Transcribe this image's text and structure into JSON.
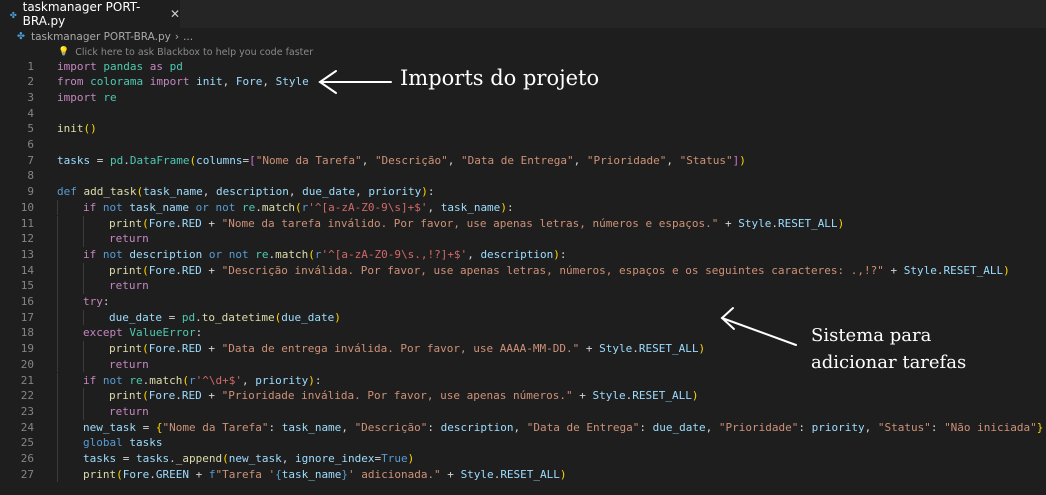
{
  "tab": {
    "label": "taskmanager PORT-BRA.py",
    "close": "✕"
  },
  "breadcrumb": {
    "file": "taskmanager PORT-BRA.py",
    "sep": "›",
    "rest": "..."
  },
  "hint": "Click here to ask Blackbox to help you code faster",
  "annotations": {
    "imports": "Imports do projeto",
    "sistema_line1": "Sistema para",
    "sistema_line2": "adicionar tarefas"
  },
  "code": [
    {
      "n": "1",
      "indent": 0,
      "tokens": [
        [
          "kw",
          "import"
        ],
        [
          "txt",
          " "
        ],
        [
          "cls",
          "pandas"
        ],
        [
          "txt",
          " "
        ],
        [
          "kw",
          "as"
        ],
        [
          "txt",
          " "
        ],
        [
          "cls",
          "pd"
        ]
      ]
    },
    {
      "n": "2",
      "indent": 0,
      "tokens": [
        [
          "kw",
          "from"
        ],
        [
          "txt",
          " "
        ],
        [
          "cls",
          "colorama"
        ],
        [
          "txt",
          " "
        ],
        [
          "kw",
          "import"
        ],
        [
          "txt",
          " "
        ],
        [
          "var",
          "init"
        ],
        [
          "txt",
          ", "
        ],
        [
          "var",
          "Fore"
        ],
        [
          "txt",
          ", "
        ],
        [
          "var",
          "Style"
        ]
      ]
    },
    {
      "n": "3",
      "indent": 0,
      "tokens": [
        [
          "kw",
          "import"
        ],
        [
          "txt",
          " "
        ],
        [
          "cls",
          "re"
        ]
      ]
    },
    {
      "n": "4",
      "indent": 0,
      "tokens": []
    },
    {
      "n": "5",
      "indent": 0,
      "tokens": [
        [
          "fn",
          "init"
        ],
        [
          "p1",
          "()"
        ]
      ]
    },
    {
      "n": "6",
      "indent": 0,
      "tokens": []
    },
    {
      "n": "7",
      "indent": 0,
      "tokens": [
        [
          "var",
          "tasks"
        ],
        [
          "txt",
          " = "
        ],
        [
          "cls",
          "pd"
        ],
        [
          "txt",
          "."
        ],
        [
          "cls",
          "DataFrame"
        ],
        [
          "p1",
          "("
        ],
        [
          "var",
          "columns"
        ],
        [
          "txt",
          "="
        ],
        [
          "p2",
          "["
        ],
        [
          "str",
          "\"Nome da Tarefa\""
        ],
        [
          "txt",
          ", "
        ],
        [
          "str",
          "\"Descrição\""
        ],
        [
          "txt",
          ", "
        ],
        [
          "str",
          "\"Data de Entrega\""
        ],
        [
          "txt",
          ", "
        ],
        [
          "str",
          "\"Prioridade\""
        ],
        [
          "txt",
          ", "
        ],
        [
          "str",
          "\"Status\""
        ],
        [
          "p2",
          "]"
        ],
        [
          "p1",
          ")"
        ]
      ]
    },
    {
      "n": "8",
      "indent": 0,
      "tokens": []
    },
    {
      "n": "9",
      "indent": 0,
      "tokens": [
        [
          "kwb",
          "def"
        ],
        [
          "txt",
          " "
        ],
        [
          "fn",
          "add_task"
        ],
        [
          "p1",
          "("
        ],
        [
          "var",
          "task_name"
        ],
        [
          "txt",
          ", "
        ],
        [
          "var",
          "description"
        ],
        [
          "txt",
          ", "
        ],
        [
          "var",
          "due_date"
        ],
        [
          "txt",
          ", "
        ],
        [
          "var",
          "priority"
        ],
        [
          "p1",
          ")"
        ],
        [
          "txt",
          ":"
        ]
      ]
    },
    {
      "n": "10",
      "indent": 1,
      "tokens": [
        [
          "kw",
          "if"
        ],
        [
          "txt",
          " "
        ],
        [
          "kwb",
          "not"
        ],
        [
          "txt",
          " "
        ],
        [
          "var",
          "task_name"
        ],
        [
          "txt",
          " "
        ],
        [
          "kwb",
          "or"
        ],
        [
          "txt",
          " "
        ],
        [
          "kwb",
          "not"
        ],
        [
          "txt",
          " "
        ],
        [
          "cls",
          "re"
        ],
        [
          "txt",
          "."
        ],
        [
          "fn",
          "match"
        ],
        [
          "p1",
          "("
        ],
        [
          "kwb",
          "r"
        ],
        [
          "rx",
          "'^[a-zA-Z0-9\\s]+$'"
        ],
        [
          "txt",
          ", "
        ],
        [
          "var",
          "task_name"
        ],
        [
          "p1",
          ")"
        ],
        [
          "txt",
          ":"
        ]
      ]
    },
    {
      "n": "11",
      "indent": 2,
      "tokens": [
        [
          "fn",
          "print"
        ],
        [
          "p1",
          "("
        ],
        [
          "var",
          "Fore"
        ],
        [
          "txt",
          "."
        ],
        [
          "var",
          "RED"
        ],
        [
          "txt",
          " + "
        ],
        [
          "str",
          "\"Nome da tarefa inválido. Por favor, use apenas letras, números e espaços.\""
        ],
        [
          "txt",
          " + "
        ],
        [
          "var",
          "Style"
        ],
        [
          "txt",
          "."
        ],
        [
          "var",
          "RESET_ALL"
        ],
        [
          "p1",
          ")"
        ]
      ]
    },
    {
      "n": "12",
      "indent": 2,
      "tokens": [
        [
          "kw",
          "return"
        ]
      ]
    },
    {
      "n": "13",
      "indent": 1,
      "tokens": [
        [
          "kw",
          "if"
        ],
        [
          "txt",
          " "
        ],
        [
          "kwb",
          "not"
        ],
        [
          "txt",
          " "
        ],
        [
          "var",
          "description"
        ],
        [
          "txt",
          " "
        ],
        [
          "kwb",
          "or"
        ],
        [
          "txt",
          " "
        ],
        [
          "kwb",
          "not"
        ],
        [
          "txt",
          " "
        ],
        [
          "cls",
          "re"
        ],
        [
          "txt",
          "."
        ],
        [
          "fn",
          "match"
        ],
        [
          "p1",
          "("
        ],
        [
          "kwb",
          "r"
        ],
        [
          "rx",
          "'^[a-zA-Z0-9\\s.,!?]+$'"
        ],
        [
          "txt",
          ", "
        ],
        [
          "var",
          "description"
        ],
        [
          "p1",
          ")"
        ],
        [
          "txt",
          ":"
        ]
      ]
    },
    {
      "n": "14",
      "indent": 2,
      "tokens": [
        [
          "fn",
          "print"
        ],
        [
          "p1",
          "("
        ],
        [
          "var",
          "Fore"
        ],
        [
          "txt",
          "."
        ],
        [
          "var",
          "RED"
        ],
        [
          "txt",
          " + "
        ],
        [
          "str",
          "\"Descrição inválida. Por favor, use apenas letras, números, espaços e os seguintes caracteres: .,!?\""
        ],
        [
          "txt",
          " + "
        ],
        [
          "var",
          "Style"
        ],
        [
          "txt",
          "."
        ],
        [
          "var",
          "RESET_ALL"
        ],
        [
          "p1",
          ")"
        ]
      ]
    },
    {
      "n": "15",
      "indent": 2,
      "tokens": [
        [
          "kw",
          "return"
        ]
      ]
    },
    {
      "n": "16",
      "indent": 1,
      "tokens": [
        [
          "kw",
          "try"
        ],
        [
          "txt",
          ":"
        ]
      ]
    },
    {
      "n": "17",
      "indent": 2,
      "tokens": [
        [
          "var",
          "due_date"
        ],
        [
          "txt",
          " = "
        ],
        [
          "cls",
          "pd"
        ],
        [
          "txt",
          "."
        ],
        [
          "fn",
          "to_datetime"
        ],
        [
          "p1",
          "("
        ],
        [
          "var",
          "due_date"
        ],
        [
          "p1",
          ")"
        ]
      ]
    },
    {
      "n": "18",
      "indent": 1,
      "tokens": [
        [
          "kw",
          "except"
        ],
        [
          "txt",
          " "
        ],
        [
          "cls",
          "ValueError"
        ],
        [
          "txt",
          ":"
        ]
      ]
    },
    {
      "n": "19",
      "indent": 2,
      "tokens": [
        [
          "fn",
          "print"
        ],
        [
          "p1",
          "("
        ],
        [
          "var",
          "Fore"
        ],
        [
          "txt",
          "."
        ],
        [
          "var",
          "RED"
        ],
        [
          "txt",
          " + "
        ],
        [
          "str",
          "\"Data de entrega inválida. Por favor, use AAAA-MM-DD.\""
        ],
        [
          "txt",
          " + "
        ],
        [
          "var",
          "Style"
        ],
        [
          "txt",
          "."
        ],
        [
          "var",
          "RESET_ALL"
        ],
        [
          "p1",
          ")"
        ]
      ]
    },
    {
      "n": "20",
      "indent": 2,
      "tokens": [
        [
          "kw",
          "return"
        ]
      ]
    },
    {
      "n": "21",
      "indent": 1,
      "tokens": [
        [
          "kw",
          "if"
        ],
        [
          "txt",
          " "
        ],
        [
          "kwb",
          "not"
        ],
        [
          "txt",
          " "
        ],
        [
          "cls",
          "re"
        ],
        [
          "txt",
          "."
        ],
        [
          "fn",
          "match"
        ],
        [
          "p1",
          "("
        ],
        [
          "kwb",
          "r"
        ],
        [
          "rx",
          "'^\\d+$'"
        ],
        [
          "txt",
          ", "
        ],
        [
          "var",
          "priority"
        ],
        [
          "p1",
          ")"
        ],
        [
          "txt",
          ":"
        ]
      ]
    },
    {
      "n": "22",
      "indent": 2,
      "tokens": [
        [
          "fn",
          "print"
        ],
        [
          "p1",
          "("
        ],
        [
          "var",
          "Fore"
        ],
        [
          "txt",
          "."
        ],
        [
          "var",
          "RED"
        ],
        [
          "txt",
          " + "
        ],
        [
          "str",
          "\"Prioridade inválida. Por favor, use apenas números.\""
        ],
        [
          "txt",
          " + "
        ],
        [
          "var",
          "Style"
        ],
        [
          "txt",
          "."
        ],
        [
          "var",
          "RESET_ALL"
        ],
        [
          "p1",
          ")"
        ]
      ]
    },
    {
      "n": "23",
      "indent": 2,
      "tokens": [
        [
          "kw",
          "return"
        ]
      ]
    },
    {
      "n": "24",
      "indent": 1,
      "tokens": [
        [
          "var",
          "new_task"
        ],
        [
          "txt",
          " = "
        ],
        [
          "p1",
          "{"
        ],
        [
          "str",
          "\"Nome da Tarefa\""
        ],
        [
          "txt",
          ": "
        ],
        [
          "var",
          "task_name"
        ],
        [
          "txt",
          ", "
        ],
        [
          "str",
          "\"Descrição\""
        ],
        [
          "txt",
          ": "
        ],
        [
          "var",
          "description"
        ],
        [
          "txt",
          ", "
        ],
        [
          "str",
          "\"Data de Entrega\""
        ],
        [
          "txt",
          ": "
        ],
        [
          "var",
          "due_date"
        ],
        [
          "txt",
          ", "
        ],
        [
          "str",
          "\"Prioridade\""
        ],
        [
          "txt",
          ": "
        ],
        [
          "var",
          "priority"
        ],
        [
          "txt",
          ", "
        ],
        [
          "str",
          "\"Status\""
        ],
        [
          "txt",
          ": "
        ],
        [
          "str",
          "\"Não iniciada\""
        ],
        [
          "p1",
          "}"
        ]
      ]
    },
    {
      "n": "25",
      "indent": 1,
      "tokens": [
        [
          "kwb",
          "global"
        ],
        [
          "txt",
          " "
        ],
        [
          "var",
          "tasks"
        ]
      ]
    },
    {
      "n": "26",
      "indent": 1,
      "tokens": [
        [
          "var",
          "tasks"
        ],
        [
          "txt",
          " = "
        ],
        [
          "var",
          "tasks"
        ],
        [
          "txt",
          "."
        ],
        [
          "fn",
          "_append"
        ],
        [
          "p1",
          "("
        ],
        [
          "var",
          "new_task"
        ],
        [
          "txt",
          ", "
        ],
        [
          "var",
          "ignore_index"
        ],
        [
          "txt",
          "="
        ],
        [
          "kwb",
          "True"
        ],
        [
          "p1",
          ")"
        ]
      ]
    },
    {
      "n": "27",
      "indent": 1,
      "tokens": [
        [
          "fn",
          "print"
        ],
        [
          "p1",
          "("
        ],
        [
          "var",
          "Fore"
        ],
        [
          "txt",
          "."
        ],
        [
          "var",
          "GREEN"
        ],
        [
          "txt",
          " + "
        ],
        [
          "kwb",
          "f"
        ],
        [
          "str",
          "\"Tarefa '"
        ],
        [
          "kwb",
          "{"
        ],
        [
          "var",
          "task_name"
        ],
        [
          "kwb",
          "}"
        ],
        [
          "str",
          "' adicionada.\""
        ],
        [
          "txt",
          " + "
        ],
        [
          "var",
          "Style"
        ],
        [
          "txt",
          "."
        ],
        [
          "var",
          "RESET_ALL"
        ],
        [
          "p1",
          ")"
        ]
      ]
    }
  ]
}
